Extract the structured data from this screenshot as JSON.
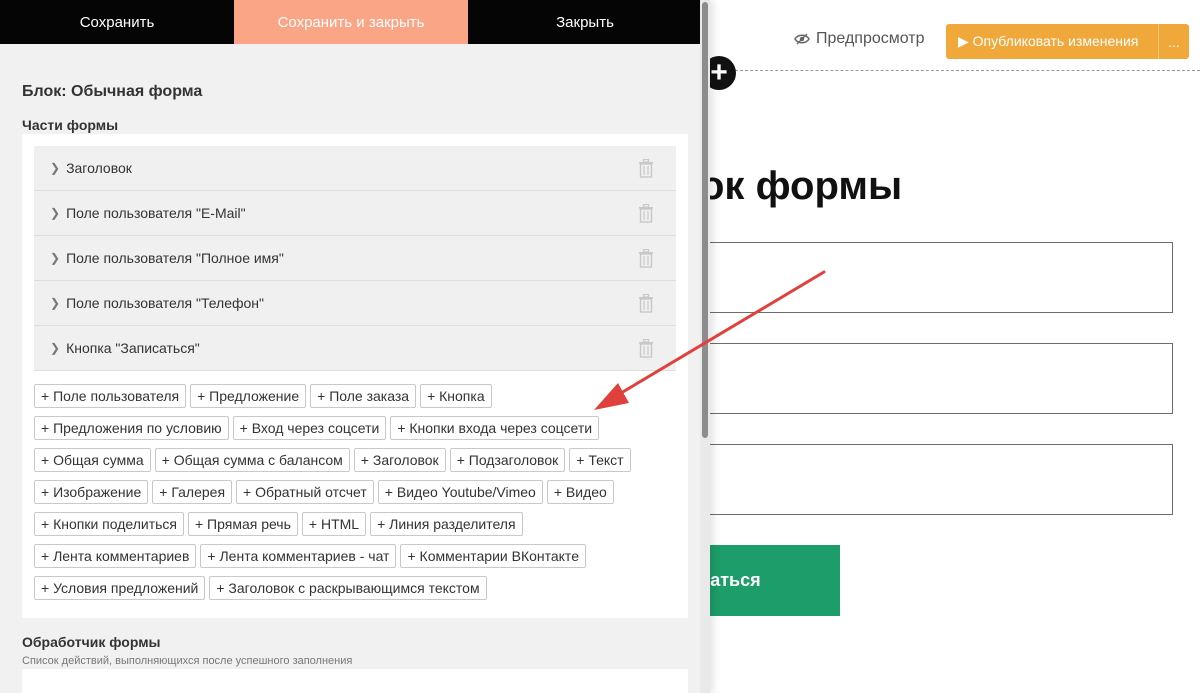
{
  "toolbar": {
    "save": "Сохранить",
    "save_close": "Сохранить и закрыть",
    "close": "Закрыть"
  },
  "top_right": {
    "preview": "Предпросмотр",
    "publish": "▶ Опубликовать изменения",
    "more": "..."
  },
  "block": {
    "title": "Блок: Обычная форма",
    "parts_title": "Части формы",
    "parts": [
      "Заголовок",
      "Поле пользователя \"E-Mail\"",
      "Поле пользователя \"Полное имя\"",
      "Поле пользователя \"Телефон\"",
      "Кнопка \"Записаться\""
    ],
    "add_buttons": [
      [
        "+ Поле пользователя",
        "+ Предложение",
        "+ Поле заказа",
        "+ Кнопка"
      ],
      [
        "+ Предложения по условию",
        "+ Вход через соцсети",
        "+ Кнопки входа через соцсети"
      ],
      [
        "+ Общая сумма",
        "+ Общая сумма с балансом",
        "+ Заголовок",
        "+ Подзаголовок",
        "+ Текст"
      ],
      [
        "+ Изображение",
        "+ Галерея",
        "+ Обратный отсчет",
        "+ Видео Youtube/Vimeo",
        "+ Видео"
      ],
      [
        "+ Кнопки поделиться",
        "+ Прямая речь",
        "+ HTML",
        "+ Линия разделителя"
      ],
      [
        "+ Лента комментариев",
        "+ Лента комментариев - чат",
        "+ Комментарии ВКонтакте"
      ],
      [
        "+ Условия предложений",
        "+ Заголовок с раскрывающимся текстом"
      ]
    ]
  },
  "handler": {
    "title": "Обработчик формы",
    "subtitle": "Список действий, выполняющихся после успешного заполнения"
  },
  "preview": {
    "title_fragment": "ок формы",
    "button_fragment": "саться"
  },
  "colors": {
    "save_close_bg": "#fba587",
    "publish_bg": "#f0a83a",
    "submit_bg": "#1c9d6a",
    "arrow": "#e0413c"
  }
}
